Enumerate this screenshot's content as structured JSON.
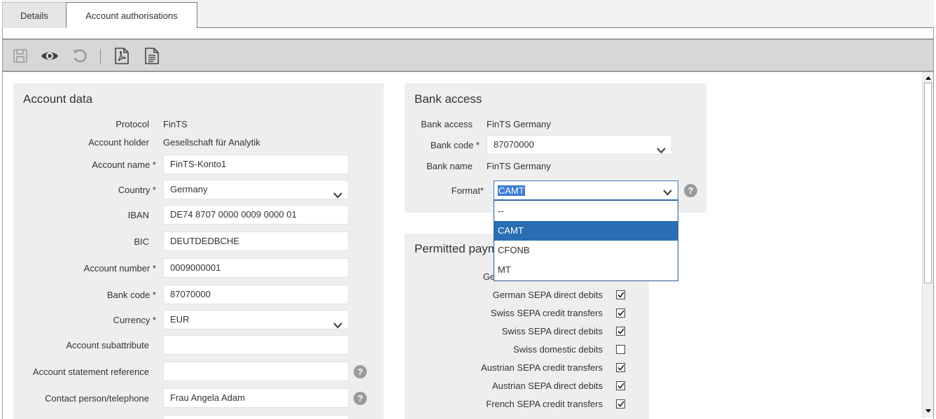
{
  "tabs": [
    {
      "label": "Details"
    },
    {
      "label": "Account authorisations"
    }
  ],
  "toolbar": {
    "icons": [
      "save-icon",
      "view-icon",
      "undo-icon",
      "pdf-icon",
      "document-icon"
    ]
  },
  "account_data": {
    "title": "Account data",
    "protocol": {
      "label": "Protocol",
      "value": "FinTS"
    },
    "account_holder": {
      "label": "Account holder",
      "value": "Gesellschaft für Analytik"
    },
    "account_name": {
      "label": "Account name *",
      "value": "FinTS-Konto1"
    },
    "country": {
      "label": "Country *",
      "value": "Germany"
    },
    "iban": {
      "label": "IBAN",
      "value": "DE74 8707 0000 0009 0000 01"
    },
    "bic": {
      "label": "BIC",
      "value": "DEUTDEDBCHE"
    },
    "account_number": {
      "label": "Account number *",
      "value": "0009000001"
    },
    "bank_code": {
      "label": "Bank code *",
      "value": "87070000"
    },
    "currency": {
      "label": "Currency *",
      "value": "EUR"
    },
    "account_subattribute": {
      "label": "Account subattribute",
      "value": ""
    },
    "account_statement_reference": {
      "label": "Account statement reference",
      "value": ""
    },
    "contact_person": {
      "label": "Contact person/telephone",
      "value": "Frau Angela Adam"
    }
  },
  "bank_access": {
    "title": "Bank access",
    "bank_access": {
      "label": "Bank access",
      "value": "FinTS Germany"
    },
    "bank_code": {
      "label": "Bank code *",
      "value": "87070000"
    },
    "bank_name": {
      "label": "Bank name",
      "value": "FinTS Germany"
    },
    "format": {
      "label": "Format*",
      "value": "CAMT"
    },
    "format_options": [
      "--",
      "CAMT",
      "CFONB",
      "MT"
    ]
  },
  "permitted_payments": {
    "title": "Permitted payments",
    "partial_label": "Ge",
    "items": [
      {
        "label": "German SEPA direct debits",
        "checked": true
      },
      {
        "label": "Swiss SEPA credit transfers",
        "checked": true
      },
      {
        "label": "Swiss SEPA direct debits",
        "checked": true
      },
      {
        "label": "Swiss domestic debits",
        "checked": false
      },
      {
        "label": "Austrian SEPA credit transfers",
        "checked": true
      },
      {
        "label": "Austrian SEPA direct debits",
        "checked": true
      },
      {
        "label": "French SEPA credit transfers",
        "checked": true
      }
    ]
  },
  "help_glyph": "?"
}
